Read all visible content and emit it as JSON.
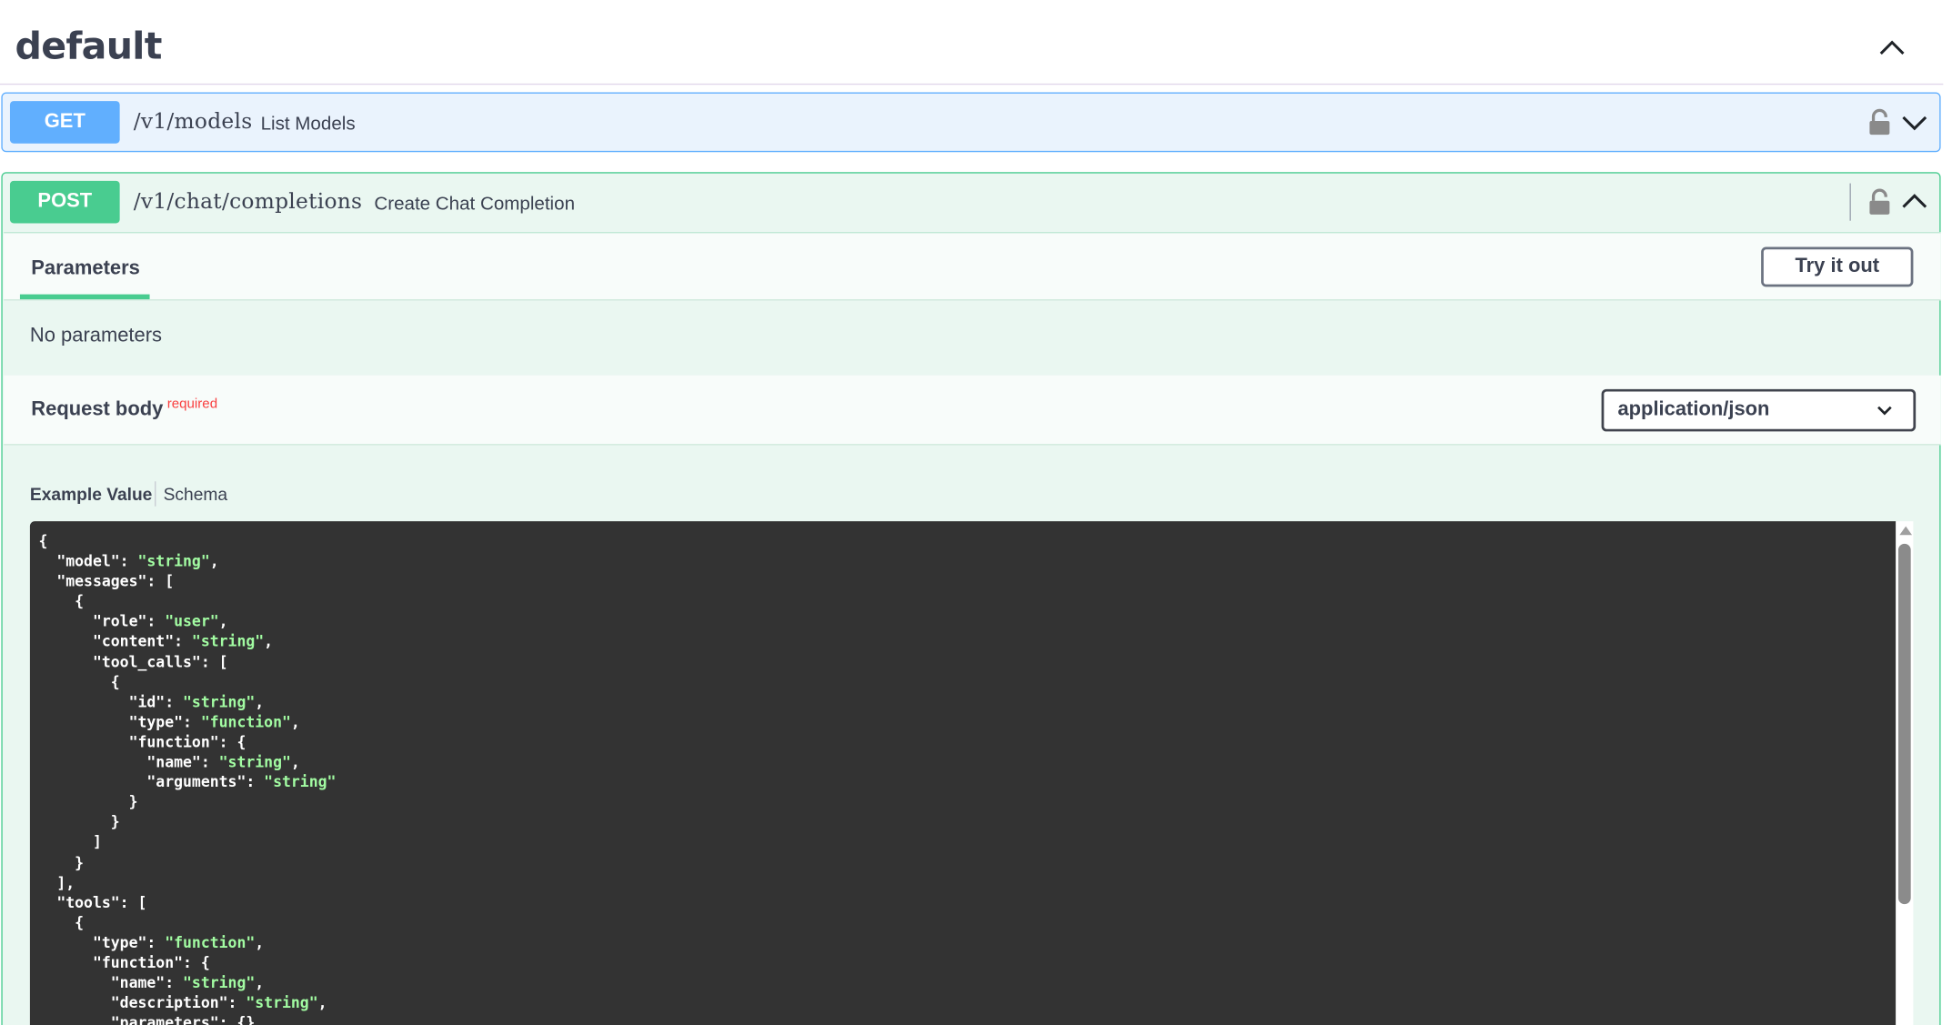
{
  "tag": {
    "title": "default"
  },
  "get_op": {
    "method": "GET",
    "path": "/v1/models",
    "summary": "List Models"
  },
  "post_op": {
    "method": "POST",
    "path": "/v1/chat/completions",
    "summary": "Create Chat Completion",
    "tab_parameters": "Parameters",
    "try_it_out": "Try it out",
    "no_parameters": "No parameters",
    "request_body_title": "Request body",
    "required_label": "required",
    "content_type": "application/json",
    "example_value_tab": "Example Value",
    "schema_tab": "Schema",
    "example_lines": [
      [
        {
          "t": "{"
        }
      ],
      [
        {
          "t": "  \"model\": "
        },
        {
          "t": "\"string\"",
          "s": 1
        },
        {
          "t": ","
        }
      ],
      [
        {
          "t": "  \"messages\": ["
        }
      ],
      [
        {
          "t": "    {"
        }
      ],
      [
        {
          "t": "      \"role\": "
        },
        {
          "t": "\"user\"",
          "s": 1
        },
        {
          "t": ","
        }
      ],
      [
        {
          "t": "      \"content\": "
        },
        {
          "t": "\"string\"",
          "s": 1
        },
        {
          "t": ","
        }
      ],
      [
        {
          "t": "      \"tool_calls\": ["
        }
      ],
      [
        {
          "t": "        {"
        }
      ],
      [
        {
          "t": "          \"id\": "
        },
        {
          "t": "\"string\"",
          "s": 1
        },
        {
          "t": ","
        }
      ],
      [
        {
          "t": "          \"type\": "
        },
        {
          "t": "\"function\"",
          "s": 1
        },
        {
          "t": ","
        }
      ],
      [
        {
          "t": "          \"function\": {"
        }
      ],
      [
        {
          "t": "            \"name\": "
        },
        {
          "t": "\"string\"",
          "s": 1
        },
        {
          "t": ","
        }
      ],
      [
        {
          "t": "            \"arguments\": "
        },
        {
          "t": "\"string\"",
          "s": 1
        }
      ],
      [
        {
          "t": "          }"
        }
      ],
      [
        {
          "t": "        }"
        }
      ],
      [
        {
          "t": "      ]"
        }
      ],
      [
        {
          "t": "    }"
        }
      ],
      [
        {
          "t": "  ],"
        }
      ],
      [
        {
          "t": "  \"tools\": ["
        }
      ],
      [
        {
          "t": "    {"
        }
      ],
      [
        {
          "t": "      \"type\": "
        },
        {
          "t": "\"function\"",
          "s": 1
        },
        {
          "t": ","
        }
      ],
      [
        {
          "t": "      \"function\": {"
        }
      ],
      [
        {
          "t": "        \"name\": "
        },
        {
          "t": "\"string\"",
          "s": 1
        },
        {
          "t": ","
        }
      ],
      [
        {
          "t": "        \"description\": "
        },
        {
          "t": "\"string\"",
          "s": 1
        },
        {
          "t": ","
        }
      ],
      [
        {
          "t": "        \"parameters\": {}"
        }
      ]
    ]
  },
  "icons": {
    "tag_toggle": "chevron-up-icon",
    "lock": "lock-icon",
    "expand": "chevron-down-icon",
    "collapse": "chevron-up-icon",
    "select": "chevron-down-icon"
  },
  "colors": {
    "get": "#61affe",
    "post": "#49cc90",
    "required": "#f93e3e",
    "code_bg": "#333333",
    "code_string": "#a2fca2"
  }
}
